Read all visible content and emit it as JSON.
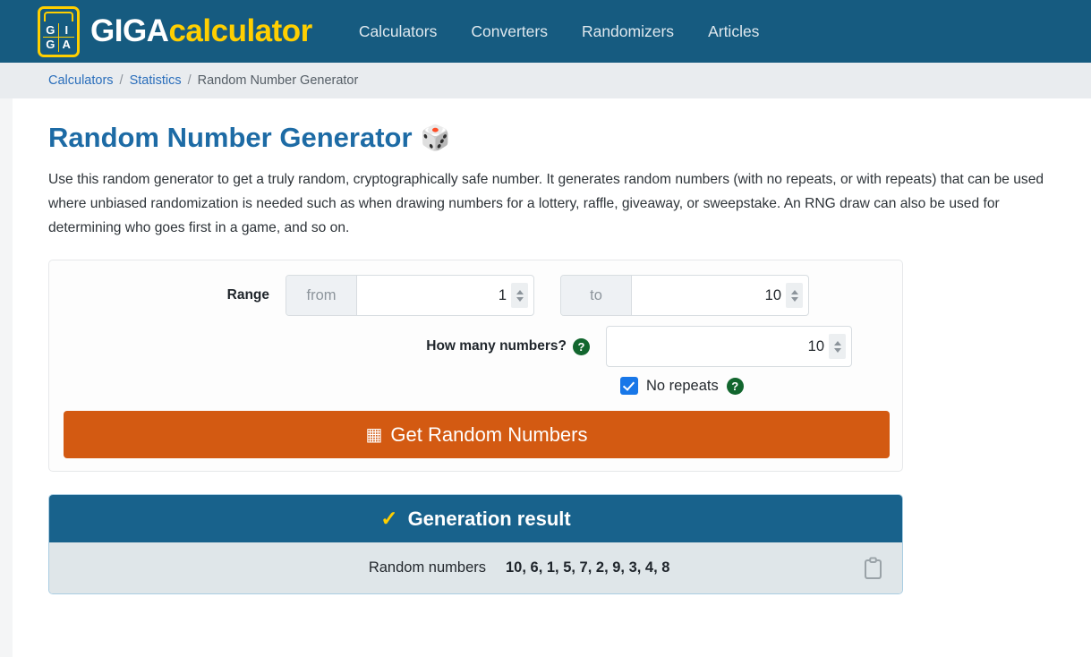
{
  "header": {
    "logo": {
      "icon_name": "giga-calculator-logo",
      "grid_letters": [
        "G",
        "I",
        "G",
        "A"
      ],
      "text_primary": "GIGA",
      "text_secondary": "calculator",
      "color_primary": "#ffffff",
      "color_secondary": "#ffcf00",
      "background": "#165b80"
    },
    "nav": [
      {
        "label": "Calculators"
      },
      {
        "label": "Converters"
      },
      {
        "label": "Randomizers"
      },
      {
        "label": "Articles"
      }
    ]
  },
  "breadcrumb": {
    "items": [
      {
        "label": "Calculators",
        "link": true
      },
      {
        "label": "Statistics",
        "link": true
      },
      {
        "label": "Random Number Generator",
        "link": false
      }
    ],
    "separator": "/"
  },
  "page": {
    "title": "Random Number Generator",
    "title_icon": "dice-icon",
    "title_icon_glyph": "🎲",
    "title_color": "#1d6ba5",
    "intro": "Use this random generator to get a truly random, cryptographically safe number. It generates random numbers (with no repeats, or with repeats) that can be used where unbiased randomization is needed such as when drawing numbers for a lottery, raffle, giveaway, or sweepstake. An RNG draw can also be used for determining who goes first in a game, and so on."
  },
  "form": {
    "range_label": "Range",
    "from_addon": "from",
    "from_value": "1",
    "to_addon": "to",
    "to_value": "10",
    "count_label": "How many numbers?",
    "count_value": "10",
    "help_glyph": "?",
    "no_repeats_label": "No repeats",
    "no_repeats_checked": true,
    "submit_label": "Get Random Numbers",
    "submit_icon": "calculator-icon",
    "submit_icon_glyph": "▦",
    "submit_color": "#d35a12"
  },
  "result": {
    "header_label": "Generation result",
    "header_icon": "check-icon",
    "header_icon_glyph": "✓",
    "header_color": "#18628c",
    "row_label": "Random numbers",
    "row_value": "10, 6, 1, 5, 7, 2, 9, 3, 4, 8",
    "copy_icon": "clipboard-icon"
  }
}
